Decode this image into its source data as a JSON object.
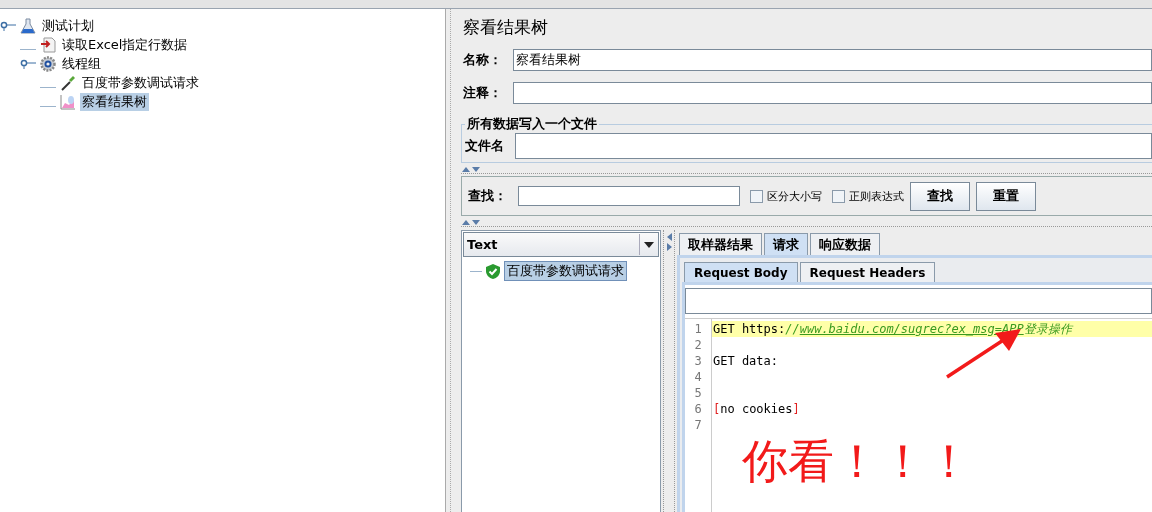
{
  "test_plan_tree": [
    {
      "label": "测试计划",
      "kind": "test-plan",
      "expanded": true,
      "selected": false,
      "children": [
        {
          "label": "读取Excel指定行数据",
          "kind": "config",
          "selected": false
        },
        {
          "label": "线程组",
          "kind": "thread-group",
          "expanded": true,
          "selected": false,
          "children": [
            {
              "label": "百度带参数调试请求",
              "kind": "sampler",
              "selected": false
            },
            {
              "label": "察看结果树",
              "kind": "listener",
              "selected": true
            }
          ]
        }
      ]
    }
  ],
  "panel": {
    "title": "察看结果树",
    "fields": [
      {
        "label": "名称：",
        "value": "察看结果树"
      },
      {
        "label": "注释："
      }
    ],
    "file_group": {
      "legend": "所有数据写入一个文件",
      "label": "文件名"
    },
    "search": {
      "label": "查找：",
      "checkboxes": [
        {
          "label": "区分大小写",
          "checked": false
        },
        {
          "label": "正则表达式",
          "checked": false
        }
      ],
      "buttons": [
        "查找",
        "重置"
      ]
    }
  },
  "results": {
    "renderer": "Text",
    "items": [
      {
        "label": "百度带参数调试请求",
        "kind": "success",
        "selected": true
      }
    ],
    "tabs": [
      {
        "label": "取样器结果",
        "selected": false
      },
      {
        "label": "请求",
        "selected": true
      },
      {
        "label": "响应数据",
        "selected": false
      }
    ],
    "subtabs": [
      {
        "label": "Request Body",
        "selected": true
      },
      {
        "label": "Request Headers",
        "selected": false
      }
    ],
    "code_lines": [
      {
        "number": "1",
        "highlighted": true,
        "segments": [
          {
            "text": "GET https:",
            "kind": "plain"
          },
          {
            "text": "//",
            "kind": "comment"
          },
          {
            "text": "www.baidu.com/sugrec?ex_msg=APP",
            "kind": "link"
          },
          {
            "text": "登录操作",
            "kind": "comment"
          }
        ]
      },
      {
        "number": "2",
        "highlighted": false
      },
      {
        "number": "3",
        "highlighted": false,
        "segments": [
          {
            "text": "GET data:",
            "kind": "plain"
          }
        ]
      },
      {
        "number": "4",
        "highlighted": false
      },
      {
        "number": "5",
        "highlighted": false
      },
      {
        "number": "6",
        "highlighted": false,
        "segments": [
          {
            "text": "[",
            "kind": "bracket"
          },
          {
            "text": "no cookies",
            "kind": "plain"
          },
          {
            "text": "]",
            "kind": "bracket"
          }
        ]
      },
      {
        "number": "7",
        "highlighted": false
      }
    ]
  },
  "annotation": {
    "text": "你看！！！"
  }
}
